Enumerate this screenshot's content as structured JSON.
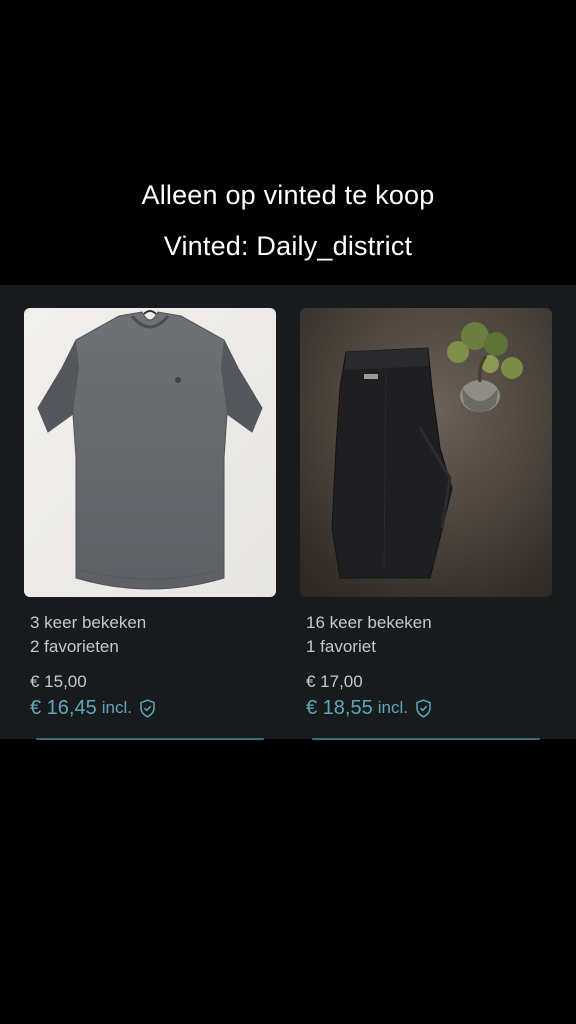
{
  "overlay": {
    "line1": "Alleen op vinted te koop",
    "line2": "Vinted: Daily_district"
  },
  "items": [
    {
      "image": "grey-tshirt",
      "views": "3 keer bekeken",
      "favorites": "2 favorieten",
      "price": "€ 15,00",
      "price_incl": "€ 16,45",
      "incl_label": "incl.",
      "icon": "shield-check-icon"
    },
    {
      "image": "black-jeans",
      "views": "16 keer bekeken",
      "favorites": "1 favoriet",
      "price": "€ 17,00",
      "price_incl": "€ 18,55",
      "incl_label": "incl.",
      "icon": "shield-check-icon"
    }
  ],
  "colors": {
    "background": "#000000",
    "panel": "#171b1e",
    "accent": "#5fa7b6",
    "text": "#c5c9cc"
  }
}
